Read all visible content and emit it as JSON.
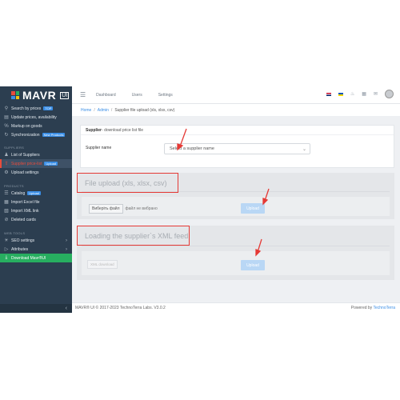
{
  "brand": {
    "name": "MAVR",
    "ui": "UI"
  },
  "topbar": {
    "links": [
      "Dashboard",
      "Users",
      "Settings"
    ],
    "icons": [
      "flag-gb-icon",
      "flag-ua-icon",
      "bell-icon",
      "grid-icon",
      "envelope-icon"
    ]
  },
  "sidebar": {
    "items_top": [
      {
        "label": "Search by prices",
        "badge": "TOP",
        "icon": "search-icon"
      },
      {
        "label": "Update prices, availability",
        "badge": "",
        "icon": "chart-icon"
      },
      {
        "label": "Markup on goods",
        "badge": "",
        "icon": "percent-icon"
      },
      {
        "label": "Synchronization",
        "badge": "New Products",
        "icon": "sync-icon"
      }
    ],
    "section_suppliers": "SUPPLIERS",
    "items_suppliers": [
      {
        "label": "List of Suppliers",
        "badge": "",
        "icon": "users-icon"
      },
      {
        "label": "Supplier price-list",
        "badge": "Upload",
        "icon": "upload-icon"
      },
      {
        "label": "Upload settings",
        "badge": "",
        "icon": "gear-icon"
      }
    ],
    "section_products": "PRODUCTS",
    "items_products": [
      {
        "label": "Catalog",
        "badge": "Upload",
        "icon": "catalog-icon"
      },
      {
        "label": "Import Excel file",
        "badge": "",
        "icon": "excel-icon"
      },
      {
        "label": "Import XML link",
        "badge": "",
        "icon": "xml-icon"
      },
      {
        "label": "Deleted cards",
        "badge": "",
        "icon": "trash-icon"
      }
    ],
    "section_tools": "WEB TOOLS",
    "items_tools": [
      {
        "label": "SEO settings",
        "icon": "seo-icon"
      },
      {
        "label": "Attributes",
        "icon": "tag-icon"
      }
    ],
    "download": "Download Mavr®UI"
  },
  "breadcrumb": {
    "home": "Home",
    "admin": "Admin",
    "current": "Supplier file upload (xls, xlsx, csv)"
  },
  "supplier_card": {
    "title_bold": "Supplier",
    "title_rest": " - download price list file",
    "label": "Supplier name",
    "select_value": "Select a supplier name"
  },
  "file_upload": {
    "title": "File upload (xls, xlsx, csv)",
    "choose_btn": "Виберіть файл",
    "no_file": "файл не вибрано",
    "upload_btn": "Upload"
  },
  "xml_feed": {
    "title": "Loading the supplier`s XML feed",
    "xml_btn": "XML download",
    "upload_btn": "Upload"
  },
  "footer": {
    "left": "MAVR® UI © 2017-2023 TechnoTerra Labs. V3.0.2",
    "right_prefix": "Powered by ",
    "right_link": "TechnoTerra"
  },
  "colors": {
    "accent": "#3a8ee6",
    "sidebar": "#2c3e50",
    "highlight": "#e53935",
    "download": "#27ae60"
  }
}
